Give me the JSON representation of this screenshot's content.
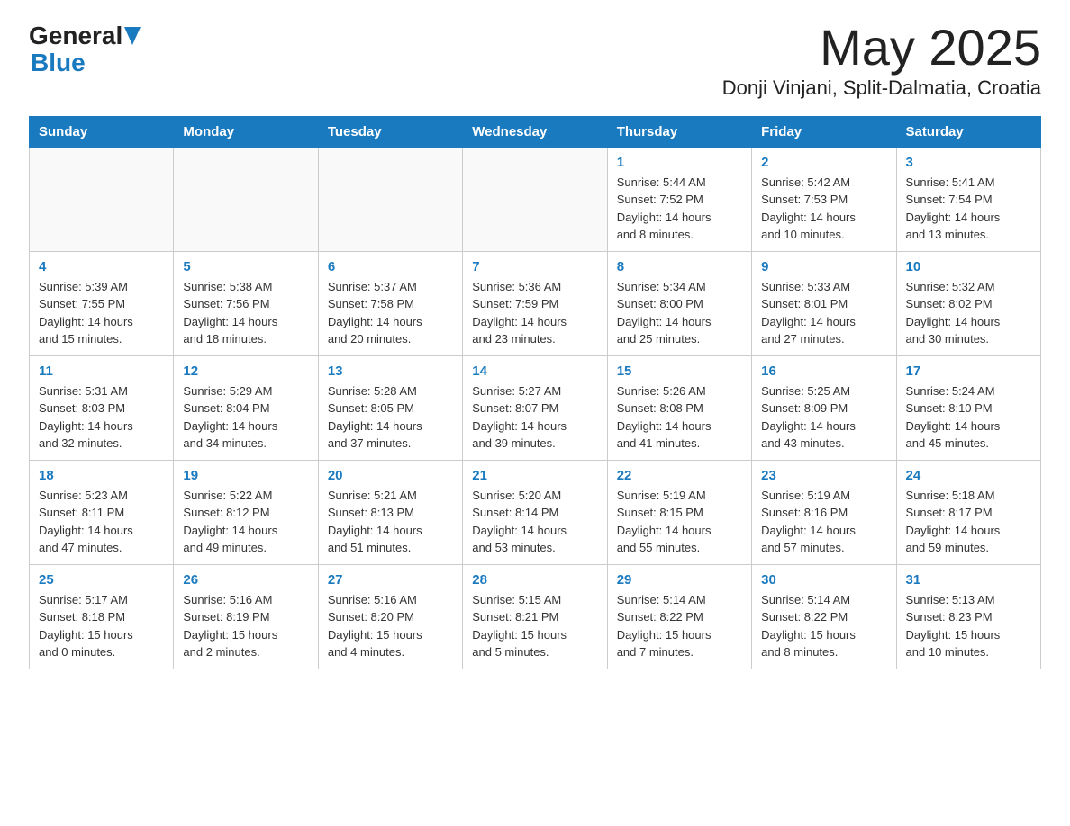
{
  "logo": {
    "general": "General",
    "blue": "Blue"
  },
  "header": {
    "month": "May 2025",
    "location": "Donji Vinjani, Split-Dalmatia, Croatia"
  },
  "days_of_week": [
    "Sunday",
    "Monday",
    "Tuesday",
    "Wednesday",
    "Thursday",
    "Friday",
    "Saturday"
  ],
  "weeks": [
    [
      {
        "day": "",
        "info": ""
      },
      {
        "day": "",
        "info": ""
      },
      {
        "day": "",
        "info": ""
      },
      {
        "day": "",
        "info": ""
      },
      {
        "day": "1",
        "info": "Sunrise: 5:44 AM\nSunset: 7:52 PM\nDaylight: 14 hours\nand 8 minutes."
      },
      {
        "day": "2",
        "info": "Sunrise: 5:42 AM\nSunset: 7:53 PM\nDaylight: 14 hours\nand 10 minutes."
      },
      {
        "day": "3",
        "info": "Sunrise: 5:41 AM\nSunset: 7:54 PM\nDaylight: 14 hours\nand 13 minutes."
      }
    ],
    [
      {
        "day": "4",
        "info": "Sunrise: 5:39 AM\nSunset: 7:55 PM\nDaylight: 14 hours\nand 15 minutes."
      },
      {
        "day": "5",
        "info": "Sunrise: 5:38 AM\nSunset: 7:56 PM\nDaylight: 14 hours\nand 18 minutes."
      },
      {
        "day": "6",
        "info": "Sunrise: 5:37 AM\nSunset: 7:58 PM\nDaylight: 14 hours\nand 20 minutes."
      },
      {
        "day": "7",
        "info": "Sunrise: 5:36 AM\nSunset: 7:59 PM\nDaylight: 14 hours\nand 23 minutes."
      },
      {
        "day": "8",
        "info": "Sunrise: 5:34 AM\nSunset: 8:00 PM\nDaylight: 14 hours\nand 25 minutes."
      },
      {
        "day": "9",
        "info": "Sunrise: 5:33 AM\nSunset: 8:01 PM\nDaylight: 14 hours\nand 27 minutes."
      },
      {
        "day": "10",
        "info": "Sunrise: 5:32 AM\nSunset: 8:02 PM\nDaylight: 14 hours\nand 30 minutes."
      }
    ],
    [
      {
        "day": "11",
        "info": "Sunrise: 5:31 AM\nSunset: 8:03 PM\nDaylight: 14 hours\nand 32 minutes."
      },
      {
        "day": "12",
        "info": "Sunrise: 5:29 AM\nSunset: 8:04 PM\nDaylight: 14 hours\nand 34 minutes."
      },
      {
        "day": "13",
        "info": "Sunrise: 5:28 AM\nSunset: 8:05 PM\nDaylight: 14 hours\nand 37 minutes."
      },
      {
        "day": "14",
        "info": "Sunrise: 5:27 AM\nSunset: 8:07 PM\nDaylight: 14 hours\nand 39 minutes."
      },
      {
        "day": "15",
        "info": "Sunrise: 5:26 AM\nSunset: 8:08 PM\nDaylight: 14 hours\nand 41 minutes."
      },
      {
        "day": "16",
        "info": "Sunrise: 5:25 AM\nSunset: 8:09 PM\nDaylight: 14 hours\nand 43 minutes."
      },
      {
        "day": "17",
        "info": "Sunrise: 5:24 AM\nSunset: 8:10 PM\nDaylight: 14 hours\nand 45 minutes."
      }
    ],
    [
      {
        "day": "18",
        "info": "Sunrise: 5:23 AM\nSunset: 8:11 PM\nDaylight: 14 hours\nand 47 minutes."
      },
      {
        "day": "19",
        "info": "Sunrise: 5:22 AM\nSunset: 8:12 PM\nDaylight: 14 hours\nand 49 minutes."
      },
      {
        "day": "20",
        "info": "Sunrise: 5:21 AM\nSunset: 8:13 PM\nDaylight: 14 hours\nand 51 minutes."
      },
      {
        "day": "21",
        "info": "Sunrise: 5:20 AM\nSunset: 8:14 PM\nDaylight: 14 hours\nand 53 minutes."
      },
      {
        "day": "22",
        "info": "Sunrise: 5:19 AM\nSunset: 8:15 PM\nDaylight: 14 hours\nand 55 minutes."
      },
      {
        "day": "23",
        "info": "Sunrise: 5:19 AM\nSunset: 8:16 PM\nDaylight: 14 hours\nand 57 minutes."
      },
      {
        "day": "24",
        "info": "Sunrise: 5:18 AM\nSunset: 8:17 PM\nDaylight: 14 hours\nand 59 minutes."
      }
    ],
    [
      {
        "day": "25",
        "info": "Sunrise: 5:17 AM\nSunset: 8:18 PM\nDaylight: 15 hours\nand 0 minutes."
      },
      {
        "day": "26",
        "info": "Sunrise: 5:16 AM\nSunset: 8:19 PM\nDaylight: 15 hours\nand 2 minutes."
      },
      {
        "day": "27",
        "info": "Sunrise: 5:16 AM\nSunset: 8:20 PM\nDaylight: 15 hours\nand 4 minutes."
      },
      {
        "day": "28",
        "info": "Sunrise: 5:15 AM\nSunset: 8:21 PM\nDaylight: 15 hours\nand 5 minutes."
      },
      {
        "day": "29",
        "info": "Sunrise: 5:14 AM\nSunset: 8:22 PM\nDaylight: 15 hours\nand 7 minutes."
      },
      {
        "day": "30",
        "info": "Sunrise: 5:14 AM\nSunset: 8:22 PM\nDaylight: 15 hours\nand 8 minutes."
      },
      {
        "day": "31",
        "info": "Sunrise: 5:13 AM\nSunset: 8:23 PM\nDaylight: 15 hours\nand 10 minutes."
      }
    ]
  ]
}
